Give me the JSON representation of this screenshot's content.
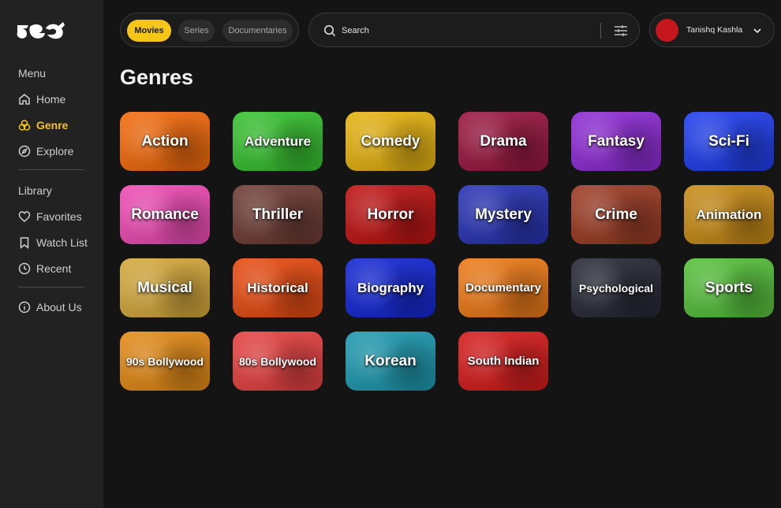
{
  "sidebar": {
    "menu_label": "Menu",
    "library_label": "Library",
    "menu_items": [
      {
        "label": "Home",
        "icon": "home-icon"
      },
      {
        "label": "Genre",
        "icon": "genre-icon",
        "active": true
      },
      {
        "label": "Explore",
        "icon": "compass-icon"
      }
    ],
    "library_items": [
      {
        "label": "Favorites",
        "icon": "heart-icon"
      },
      {
        "label": "Watch List",
        "icon": "bookmark-icon"
      },
      {
        "label": "Recent",
        "icon": "clock-icon"
      }
    ],
    "about_label": "About Us"
  },
  "topbar": {
    "tabs": [
      {
        "label": "Movies",
        "active": true
      },
      {
        "label": "Series",
        "active": false
      },
      {
        "label": "Documentaries",
        "active": false
      }
    ],
    "search_placeholder": "Search",
    "user_name": "Tanishq Kashla"
  },
  "page": {
    "title": "Genres"
  },
  "colors": {
    "accent": "#f5c518",
    "sidebar": "#222222",
    "background": "#141414",
    "avatar": "#c4161c"
  },
  "genres": [
    {
      "label": "Action",
      "color": "#f56a0a"
    },
    {
      "label": "Adventure",
      "color": "#35c22e"
    },
    {
      "label": "Comedy",
      "color": "#e8b40f"
    },
    {
      "label": "Drama",
      "color": "#9b1541"
    },
    {
      "label": "Fantasy",
      "color": "#8e2ad6"
    },
    {
      "label": "Sci-Fi",
      "color": "#1f3df0"
    },
    {
      "label": "Romance",
      "color": "#f04ab5"
    },
    {
      "label": "Thriller",
      "color": "#6e3b33"
    },
    {
      "label": "Horror",
      "color": "#c11212"
    },
    {
      "label": "Mystery",
      "color": "#2732b5"
    },
    {
      "label": "Crime",
      "color": "#9c3a22"
    },
    {
      "label": "Animation",
      "color": "#c98b14"
    },
    {
      "label": "Musical",
      "color": "#d6a93a"
    },
    {
      "label": "Historical",
      "color": "#ea4a10"
    },
    {
      "label": "Biography",
      "color": "#1226d6"
    },
    {
      "label": "Documentary",
      "color": "#ef7a16"
    },
    {
      "label": "Psychological",
      "color": "#252835"
    },
    {
      "label": "Sports",
      "color": "#55c23a"
    },
    {
      "label": "90s Bollywood",
      "color": "#e58a14"
    },
    {
      "label": "80s Bollywood",
      "color": "#e84040"
    },
    {
      "label": "Korean",
      "color": "#1c9ab0"
    },
    {
      "label": "South Indian",
      "color": "#d81a1a"
    }
  ]
}
